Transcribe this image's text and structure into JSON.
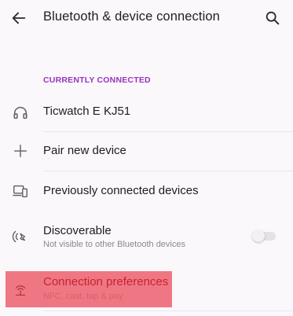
{
  "header": {
    "title": "Bluetooth & device connection"
  },
  "section": {
    "currently_connected": "CURRENTLY CONNECTED"
  },
  "devices": {
    "ticwatch": "Ticwatch E KJ51"
  },
  "actions": {
    "pair_new": "Pair new device",
    "previously_connected": "Previously connected devices"
  },
  "discoverable": {
    "label": "Discoverable",
    "summary": "Not visible to other Bluetooth devices",
    "enabled": false
  },
  "connection_preferences": {
    "label": "Connection preferences",
    "summary": "NFC, cast, tap & pay"
  },
  "colors": {
    "accent": "#9933c0",
    "highlight": "#ec606e"
  }
}
